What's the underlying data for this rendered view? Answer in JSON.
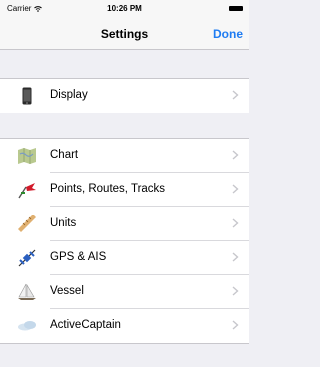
{
  "status": {
    "carrier": "Carrier",
    "time": "10:26 PM"
  },
  "nav": {
    "title": "Settings",
    "done_label": "Done"
  },
  "groups": [
    {
      "items": [
        {
          "label": "Display",
          "icon": "phone-icon"
        }
      ]
    },
    {
      "items": [
        {
          "label": "Chart",
          "icon": "map-icon"
        },
        {
          "label": "Points, Routes, Tracks",
          "icon": "flag-icon"
        },
        {
          "label": "Units",
          "icon": "ruler-icon"
        },
        {
          "label": "GPS & AIS",
          "icon": "satellite-icon"
        },
        {
          "label": "Vessel",
          "icon": "sailboat-icon"
        },
        {
          "label": "ActiveCaptain",
          "icon": "cloud-icon"
        }
      ]
    }
  ],
  "colors": {
    "accent": "#1f7cf2",
    "background": "#efeff4",
    "separator": "#c8c7cc"
  }
}
